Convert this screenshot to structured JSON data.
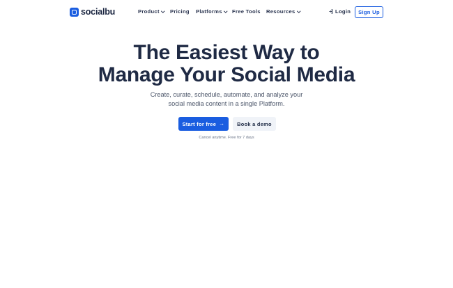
{
  "brand": {
    "name": "socialbu"
  },
  "nav": {
    "items": [
      {
        "label": "Product",
        "dropdown": true
      },
      {
        "label": "Pricing",
        "dropdown": false
      },
      {
        "label": "Platforms",
        "dropdown": true
      },
      {
        "label": "Free Tools",
        "dropdown": false
      },
      {
        "label": "Resources",
        "dropdown": true
      }
    ],
    "login_label": "Login",
    "signup_label": "Sign Up"
  },
  "hero": {
    "title_line1": "The Easiest Way to",
    "title_line2": "Manage Your Social Media",
    "subtitle_line1": "Create, curate, schedule, automate, and analyze your",
    "subtitle_line2": "social media content in a single Platform.",
    "primary_cta": "Start for free",
    "secondary_cta": "Book a demo",
    "note": "Cancel anytime. Free for 7 days"
  },
  "colors": {
    "accent": "#1a5de0",
    "text": "#1f2a44",
    "muted": "#4a5468"
  }
}
